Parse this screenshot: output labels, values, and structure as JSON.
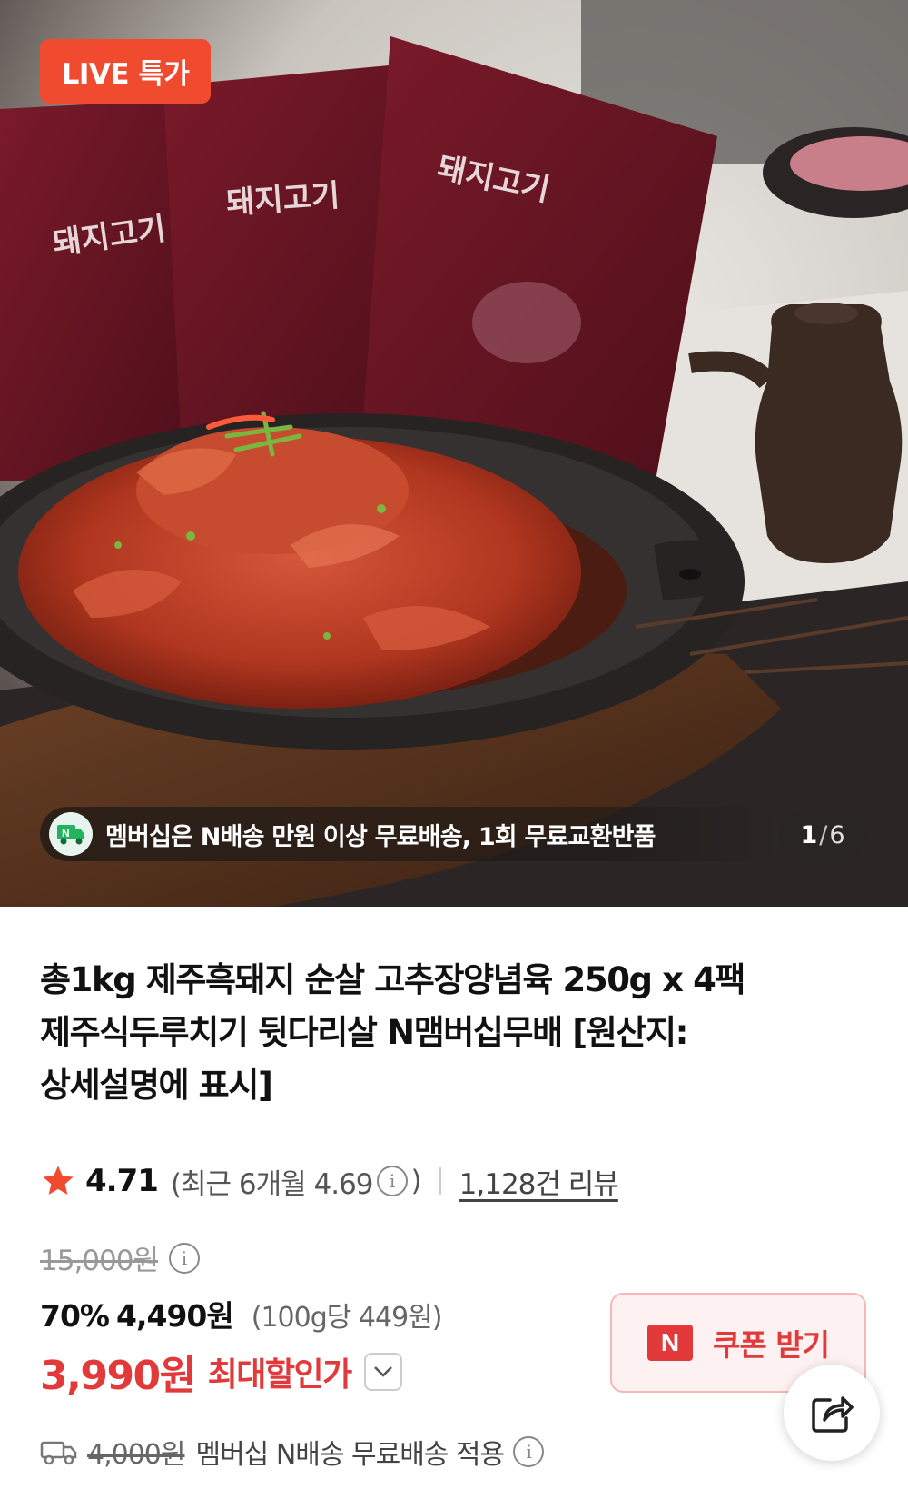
{
  "hero": {
    "badge": "LIVE 특가",
    "package_text": "돼지고기",
    "membership_notice": "멤버십은 N배송 만원 이상 무료배송, 1회 무료교환반품",
    "counter": {
      "current": "1",
      "separator": "/",
      "total": "6"
    }
  },
  "product": {
    "title_lines": [
      "총1kg 제주흑돼지 순살 고추장양념육 250g x 4팩",
      "제주식두루치기 뒷다리살 N맴버십무배 [원산지:",
      "상세설명에 표시]"
    ],
    "rating": {
      "score": "4.71",
      "recent_prefix": "(최근 6개월 4.69",
      "recent_suffix": ")",
      "reviews": "1,128건 리뷰"
    },
    "price": {
      "original": "15,000원",
      "discount_percent": "70%",
      "sale": "4,490원",
      "unit": "(100g당 449원)",
      "final": "3,990원",
      "final_label": "최대할인가"
    },
    "coupon": {
      "n_mark": "N",
      "label": "쿠폰 받기"
    },
    "shipping": {
      "original_fee": "4,000원",
      "text": "멤버십 N배송 무료배송 적용"
    }
  },
  "colors": {
    "accent": "#e23a3a",
    "badge": "#f04a2f",
    "coupon_bg": "#fdf1f1"
  },
  "icons": [
    "star-icon",
    "info-icon",
    "chevron-down-icon",
    "share-icon",
    "truck-icon",
    "n-delivery-icon"
  ]
}
